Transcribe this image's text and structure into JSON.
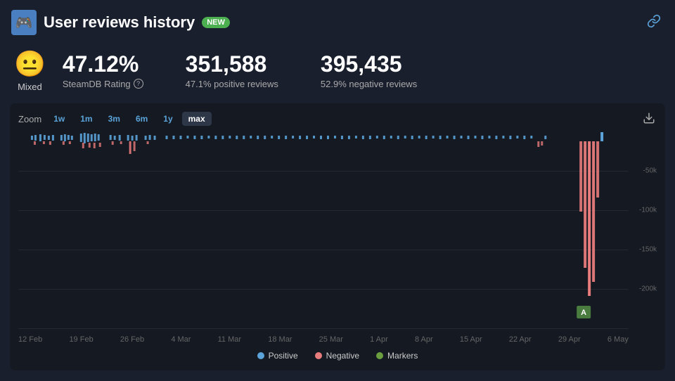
{
  "header": {
    "title": "User reviews history",
    "badge": "NEW",
    "app_icon": "🎮"
  },
  "stats": {
    "sentiment_emoji": "😐",
    "sentiment_label": "Mixed",
    "rating_value": "47.12%",
    "rating_label": "SteamDB Rating",
    "positive_count": "351,588",
    "positive_label": "47.1% positive reviews",
    "negative_count": "395,435",
    "negative_label": "52.9% negative reviews"
  },
  "zoom": {
    "label": "Zoom",
    "options": [
      "1w",
      "1m",
      "3m",
      "6m",
      "1y",
      "max"
    ],
    "active": "max"
  },
  "chart": {
    "y_labels": [
      "-50k",
      "-100k",
      "-150k",
      "-200k"
    ],
    "x_labels": [
      "12 Feb",
      "19 Feb",
      "26 Feb",
      "4 Mar",
      "11 Mar",
      "18 Mar",
      "25 Mar",
      "1 Apr",
      "8 Apr",
      "15 Apr",
      "22 Apr",
      "29 Apr",
      "6 May"
    ]
  },
  "legend": {
    "items": [
      {
        "label": "Positive",
        "color": "#5ba3d9"
      },
      {
        "label": "Negative",
        "color": "#e87b7b"
      },
      {
        "label": "Markers",
        "color": "#6a9e3f"
      }
    ]
  },
  "download_icon": "⬇",
  "link_icon": "🔗"
}
